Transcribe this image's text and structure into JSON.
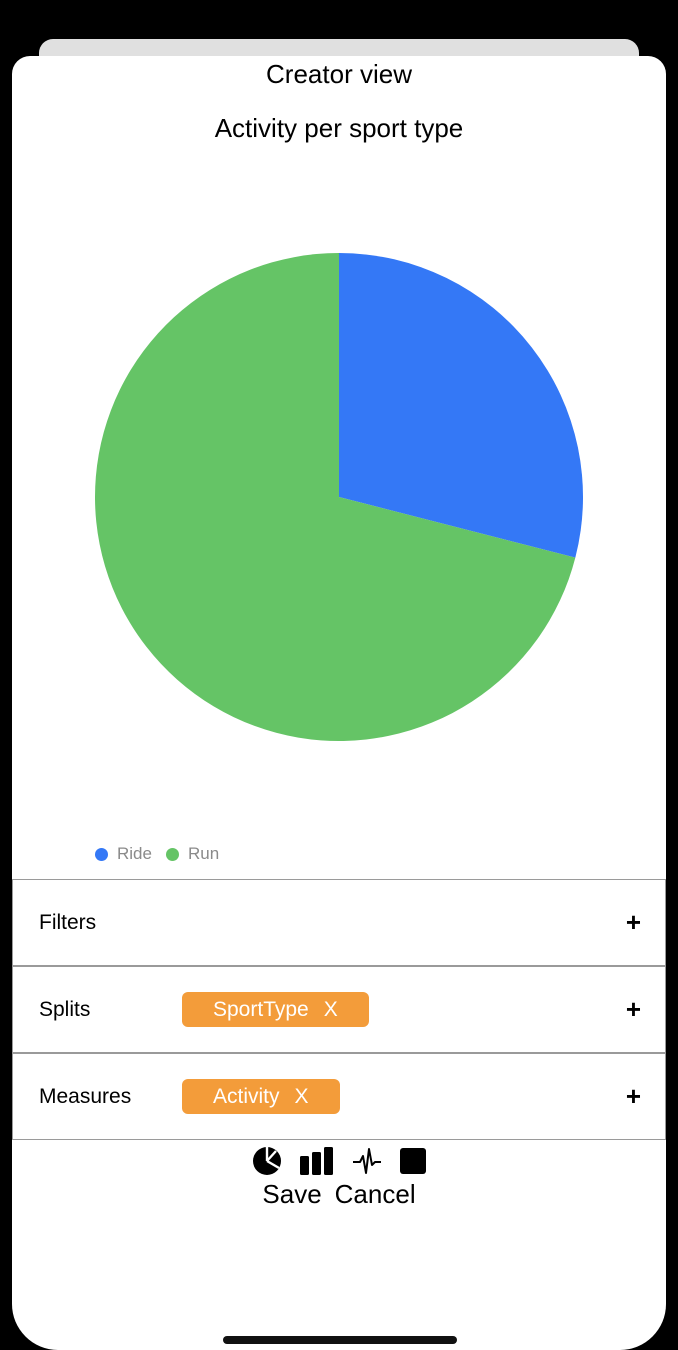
{
  "header": {
    "title": "Creator view"
  },
  "chart_data": {
    "type": "pie",
    "title": "Activity per sport type",
    "slices": [
      {
        "name": "Ride",
        "value": 0.29,
        "color": "#3478f6"
      },
      {
        "name": "Run",
        "value": 0.71,
        "color": "#65c466"
      }
    ],
    "legend_position": "bottom-left"
  },
  "panels": {
    "filters": {
      "label": "Filters",
      "add": "+"
    },
    "splits": {
      "label": "Splits",
      "chip_label": "SportType",
      "chip_remove": "X",
      "add": "+"
    },
    "measures": {
      "label": "Measures",
      "chip_label": "Activity",
      "chip_remove": "X",
      "add": "+"
    }
  },
  "chart_types": [
    "pie-chart-icon",
    "bar-chart-icon",
    "line-chart-icon",
    "table-icon"
  ],
  "actions": {
    "save": "Save",
    "cancel": "Cancel"
  },
  "colors": {
    "chip": "#f39c3a",
    "ride": "#3478f6",
    "run": "#65c466"
  }
}
